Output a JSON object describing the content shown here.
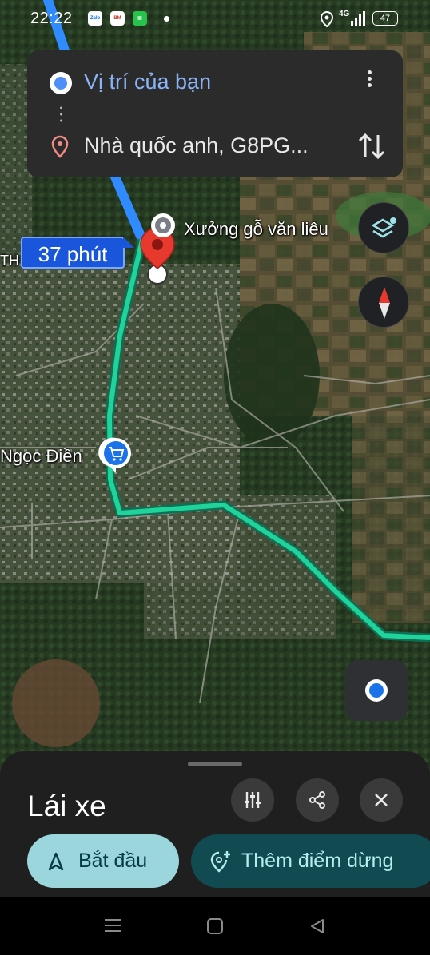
{
  "status_bar": {
    "time": "22:22",
    "apps": [
      "Zalo",
      "BÁO MỚI"
    ],
    "network": "4G",
    "battery": "47"
  },
  "directions": {
    "origin": "Vị trí của bạn",
    "destination": "Nhà quốc anh, G8PG...",
    "origin_icon": "current-location-dot-icon",
    "destination_icon": "location-pin-icon",
    "menu_icon": "more-vert-icon",
    "swap_icon": "swap-vertical-icon"
  },
  "map": {
    "eta_label": "37 phút",
    "place_wood": "Xưởng gỗ văn liêu",
    "place_shop": "Ngọc Điền",
    "partial_label": "TH",
    "route_color": "#1fd39a",
    "traveled_color": "#2f8bff",
    "pin_color": "#e8392f"
  },
  "sheet": {
    "mode": "Lái xe",
    "start_label": "Bắt đầu",
    "add_stop_label": "Thêm điểm dừng"
  }
}
